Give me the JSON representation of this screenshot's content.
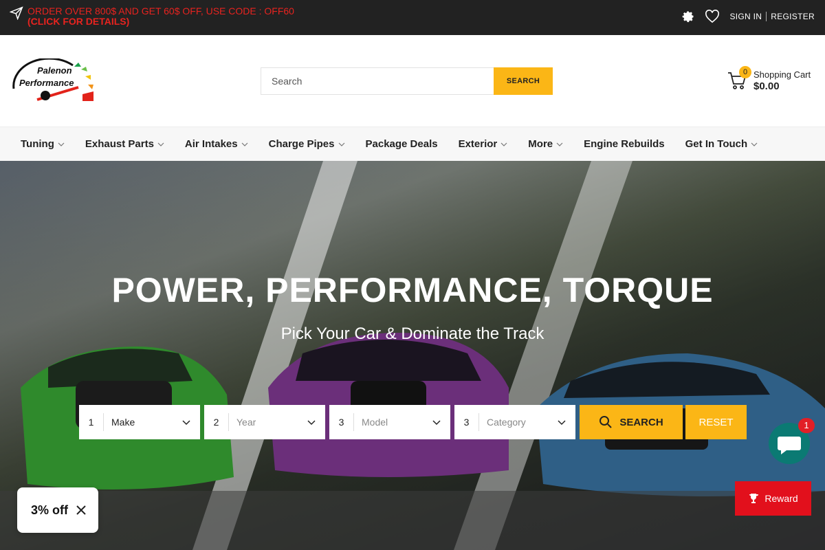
{
  "topbar": {
    "promo_line1": "ORDER OVER 800$ AND GET 60$ OFF, USE CODE : OFF60",
    "promo_line2": "(CLICK FOR DETAILS)",
    "sign_in": "SIGN IN",
    "register": "REGISTER",
    "icons": [
      "send-icon",
      "gear-icon",
      "heart-icon"
    ]
  },
  "header": {
    "logo_text_1": "Palenon",
    "logo_text_2": "Performance",
    "search_placeholder": "Search",
    "search_button": "SEARCH",
    "cart_count": "0",
    "cart_label": "Shopping Cart",
    "cart_total": "$0.00"
  },
  "nav": {
    "items": [
      {
        "label": "Tuning",
        "dropdown": true
      },
      {
        "label": "Exhaust Parts",
        "dropdown": true
      },
      {
        "label": "Air Intakes",
        "dropdown": true
      },
      {
        "label": "Charge Pipes",
        "dropdown": true
      },
      {
        "label": "Package Deals",
        "dropdown": false
      },
      {
        "label": "Exterior",
        "dropdown": true
      },
      {
        "label": "More",
        "dropdown": true
      },
      {
        "label": "Engine Rebuilds",
        "dropdown": false
      },
      {
        "label": "Get In Touch",
        "dropdown": true
      }
    ]
  },
  "hero": {
    "title": "POWER, PERFORMANCE, TORQUE",
    "subtitle": "Pick Your Car & Dominate the Track",
    "finder": {
      "selects": [
        {
          "num": "1",
          "label": "Make"
        },
        {
          "num": "2",
          "label": "Year"
        },
        {
          "num": "3",
          "label": "Model"
        },
        {
          "num": "3",
          "label": "Category"
        }
      ],
      "search_button": "SEARCH",
      "reset_button": "RESET"
    }
  },
  "widgets": {
    "discount_text": "3% off",
    "chat_badge": "1",
    "reward_label": "Reward"
  },
  "colors": {
    "accent": "#fbb616",
    "promo_red": "#e8231f",
    "topbar_bg": "#222222",
    "chat_green": "#0b7a73",
    "reward_red": "#e2101c"
  }
}
